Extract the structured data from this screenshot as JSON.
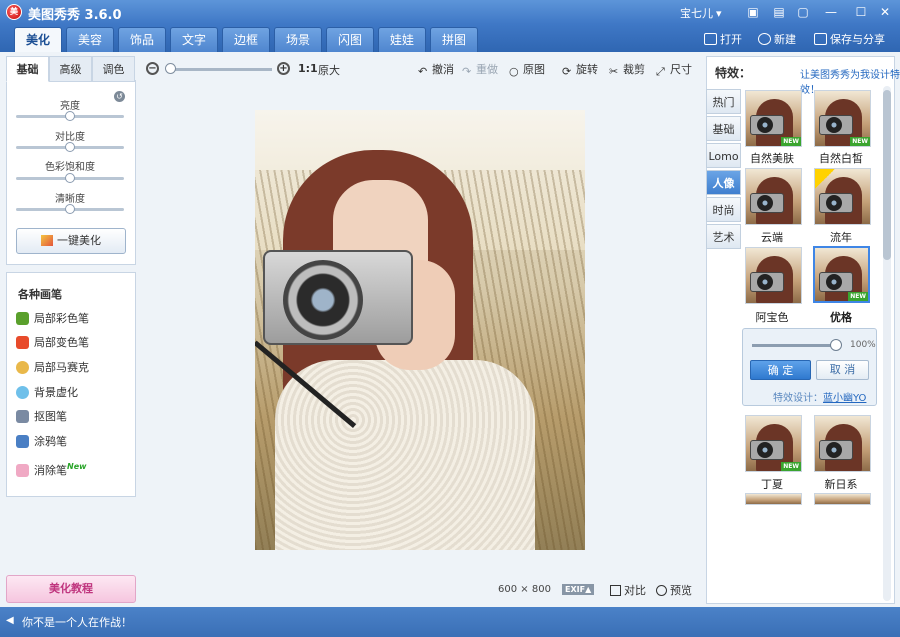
{
  "titlebar": {
    "logo": "美",
    "title": "美图秀秀 3.6.0",
    "user": "宝七儿",
    "buttons": [
      "screenshot-icon",
      "skin-icon",
      "menu-icon",
      "minimize-icon",
      "maximize-icon",
      "close-icon"
    ],
    "btn_glyphs": [
      "▣",
      "▤",
      "▢",
      "—",
      "☐",
      "✕"
    ]
  },
  "main_tabs": [
    "美化",
    "美容",
    "饰品",
    "文字",
    "边框",
    "场景",
    "闪图",
    "娃娃",
    "拼图"
  ],
  "active_tab": "美化",
  "file_actions": {
    "open": "打开",
    "new": "新建",
    "save": "保存与分享"
  },
  "left_panel": {
    "tabs": [
      "基础",
      "高级",
      "调色"
    ],
    "sliders": [
      {
        "label": "亮度",
        "value": 0.5
      },
      {
        "label": "对比度",
        "value": 0.5
      },
      {
        "label": "色彩饱和度",
        "value": 0.5
      },
      {
        "label": "清晰度",
        "value": 0.5
      }
    ],
    "one_key": "一键美化",
    "brushes_title": "各种画笔",
    "brushes": [
      {
        "label": "局部彩色笔",
        "icon": "color-brush-icon",
        "color": "#5aa02c"
      },
      {
        "label": "局部变色笔",
        "icon": "recolor-brush-icon",
        "color": "#e84b2b"
      },
      {
        "label": "局部马赛克",
        "icon": "mosaic-brush-icon",
        "color": "#e9b84a"
      },
      {
        "label": "背景虚化",
        "icon": "blur-bg-icon",
        "color": "#6fc0ea"
      },
      {
        "label": "抠图笔",
        "icon": "cutout-brush-icon",
        "color": "#7a8aa2"
      },
      {
        "label": "涂鸦笔",
        "icon": "doodle-brush-icon",
        "color": "#4a7fc4"
      },
      {
        "label": "消除笔",
        "icon": "eraser-brush-icon",
        "color": "#f0a9c4",
        "badge": "New"
      }
    ],
    "tutorial": "美化教程"
  },
  "canvas_toolbar": {
    "ratio": "1:1",
    "original": "原大",
    "tools": [
      {
        "label": "撤消",
        "icon": "undo-icon",
        "enabled": true
      },
      {
        "label": "重做",
        "icon": "redo-icon",
        "enabled": false
      },
      {
        "label": "原图",
        "icon": "original-icon",
        "enabled": true
      },
      {
        "label": "旋转",
        "icon": "rotate-icon",
        "enabled": true
      },
      {
        "label": "裁剪",
        "icon": "crop-icon",
        "enabled": true
      },
      {
        "label": "尺寸",
        "icon": "resize-icon",
        "enabled": true
      }
    ]
  },
  "image_info": {
    "width": "600",
    "times": "×",
    "height": "800",
    "exif": "EXIF▲",
    "compare": "对比",
    "preview": "预览"
  },
  "right_panel": {
    "title": "特效：",
    "link": "让美图秀秀为我设计特效！",
    "categories": [
      "热门",
      "基础",
      "Lomo",
      "人像",
      "时尚",
      "艺术"
    ],
    "active_category": "人像",
    "effects": [
      {
        "label": "自然美肤",
        "badge": "NEW"
      },
      {
        "label": "自然白皙",
        "badge": "NEW"
      },
      {
        "label": "云端"
      },
      {
        "label": "流年",
        "badge_color": "#ffd200"
      },
      {
        "label": "阿宝色"
      },
      {
        "label": "优格",
        "badge": "NEW",
        "selected": true
      },
      {
        "label": "丁夏",
        "badge": "NEW"
      },
      {
        "label": "新日系"
      }
    ],
    "adjust": {
      "percent": "100%",
      "value": 1.0,
      "ok": "确 定",
      "cancel": "取 消",
      "designer_prefix": "特效设计：",
      "designer": "蓝小幽YO"
    }
  },
  "status": {
    "message": "你不是一个人在作战！"
  }
}
